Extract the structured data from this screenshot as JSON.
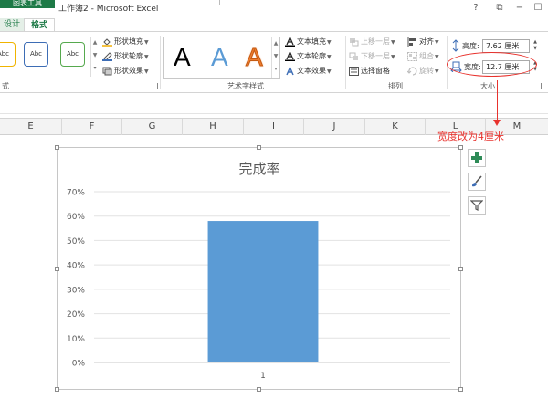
{
  "window": {
    "tool_tab_group": "图表工具",
    "title": "工作簿2 - Microsoft Excel",
    "controls": {
      "help": "?",
      "restore_ribbon": "⧉",
      "minimize": "−",
      "maximize": "☐"
    }
  },
  "tabs": [
    {
      "label": "设计",
      "active": false
    },
    {
      "label": "格式",
      "active": true
    }
  ],
  "ribbon": {
    "shape_styles": {
      "label": "式",
      "gallery": [
        "Abc",
        "Abc",
        "Abc"
      ],
      "commands": [
        "形状填充",
        "形状轮廓",
        "形状效果"
      ]
    },
    "wordart_styles": {
      "label": "艺术字样式",
      "gallery": [
        "A",
        "A",
        "A"
      ],
      "commands": [
        "文本填充",
        "文本轮廓",
        "文本效果"
      ]
    },
    "arrange": {
      "label": "排列",
      "commands": [
        "上移一层",
        "下移一层",
        "选择窗格",
        "对齐",
        "组合",
        "旋转"
      ]
    },
    "size": {
      "label": "大小",
      "height_label": "高度:",
      "height_value": "7.62 厘米",
      "width_label": "宽度:",
      "width_value": "12.7 厘米"
    }
  },
  "columns": [
    "E",
    "F",
    "G",
    "H",
    "I",
    "J",
    "K",
    "L",
    "M"
  ],
  "annotation": {
    "text": "宽度改为4厘米",
    "color": "#e8322d"
  },
  "colors": {
    "excel_green": "#1e7a47",
    "bar": "#5b9bd5",
    "annotation": "#e8322d"
  },
  "chart_buttons": [
    "plus-icon",
    "brush-icon",
    "filter-icon"
  ],
  "chart_data": {
    "type": "bar",
    "title": "完成率",
    "categories": [
      "1"
    ],
    "values": [
      0.58
    ],
    "ylim": [
      0,
      0.7
    ],
    "yticks": [
      "0%",
      "10%",
      "20%",
      "30%",
      "40%",
      "50%",
      "60%",
      "70%"
    ],
    "grid": true,
    "legend": false,
    "bar_color": "#5b9bd5"
  }
}
